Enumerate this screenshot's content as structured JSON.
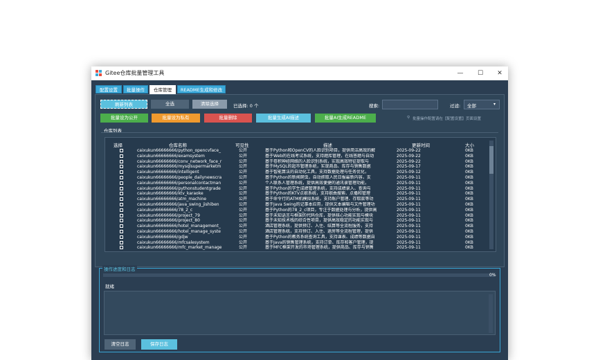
{
  "window": {
    "title": "Gitee仓库批量管理工具",
    "controls": {
      "minimize": "—",
      "maximize": "☐",
      "close": "✕"
    }
  },
  "tabs": [
    {
      "label": "配置设置",
      "active": false
    },
    {
      "label": "批量操作",
      "active": false
    },
    {
      "label": "仓库管理",
      "active": true
    },
    {
      "label": "README生成和修改",
      "active": false
    }
  ],
  "toolbar": {
    "refresh_label": "刷新列表",
    "select_all_label": "全选",
    "clear_selection_label": "清除选择",
    "selected_count": "已选择: 0 个",
    "search_label": "搜索:",
    "search_value": "",
    "filter_label": "过滤:",
    "filter_value": "全部",
    "set_public_label": "批量设为公开",
    "set_private_label": "批量设为私有",
    "delete_label": "批量删除",
    "ai_desc_label": "批量生成AI描述",
    "ai_readme_label": "批量AI生成README",
    "hint": "批量操作配置请在【配置设置】页面设置"
  },
  "repo_list": {
    "title": "仓库列表",
    "columns": [
      "选择",
      "仓库名称",
      "可见性",
      "描述",
      "更新时间",
      "大小"
    ],
    "rows": [
      [
        "caixukun66666666/python_opencvface_",
        "公开",
        "基于Python和OpenCV的人脸识别项目，提供简洁高效的解",
        "2025-09-22",
        "0KB"
      ],
      [
        "caixukun66666666/examsystem",
        "公开",
        "基于Web的在线考试系统，支持题库管理，在线答题与自动",
        "2025-09-22",
        "0KB"
      ],
      [
        "caixukun66666666/conv_network_face_r",
        "公开",
        "基于卷积神经网络的人脸识别系统，实现高效特征提取与",
        "2025-09-22",
        "0KB"
      ],
      [
        "caixukun66666666/mysqlsupermarketm",
        "公开",
        "基于MySQL的超市管理系统，实现商品、库存与销售数据",
        "2025-09-17",
        "0KB"
      ],
      [
        "caixukun66666666/intelligent",
        "公开",
        "基于智能算法的自动化工具，支持数据处理与任务优化，",
        "2025-09-12",
        "0KB"
      ],
      [
        "caixukun66666666/people_dailynewscra",
        "公开",
        "基于Python的新闻爬虫，自动抓取人民日报最新内容，支",
        "2025-09-11",
        "0KB"
      ],
      [
        "caixukun66666666/personalcontactman",
        "公开",
        "个人联系人管理系统，提供高效便捷的通讯录管理功能，",
        "2025-09-11",
        "0KB"
      ],
      [
        "caixukun66666666/pythonstudentgrade",
        "公开",
        "基于Python的学生成绩管理系统，支持成绩录入、查询与",
        "2025-09-11",
        "0KB"
      ],
      [
        "caixukun66666666/ktv_karaoke",
        "公开",
        "基于Python的KTV点歌系统，支持歌曲搜索、点播和管理",
        "2025-09-11",
        "0KB"
      ],
      [
        "caixukun66666666/atm_machine",
        "公开",
        "基于命令行的ATM机模拟系统，支持账户管理、存取款等功",
        "2025-09-11",
        "0KB"
      ],
      [
        "caixukun66666666/java_swing_jishiben",
        "公开",
        "基于Java Swing的记事本应用，提供文本编辑与文件管理功",
        "2025-09-11",
        "0KB"
      ],
      [
        "caixukun66666666/78_2_c",
        "公开",
        "基于Python的78_2_c项目，专注于数据处理与分析，提供高",
        "2025-09-11",
        "0KB"
      ],
      [
        "caixukun66666666/project_79",
        "公开",
        "基于未知语言与框架的代码仓库，提供核心功能实现与模块",
        "2025-09-11",
        "0KB"
      ],
      [
        "caixukun66666666/project_80",
        "公开",
        "基于未知技术栈的综合性项目，提供高效稳定的功能实现与",
        "2025-09-11",
        "0KB"
      ],
      [
        "caixukun66666666/hotel_management_",
        "公开",
        "酒店管理系统，提供预订、入住、结算等全流程服务，支持",
        "2025-09-11",
        "0KB"
      ],
      [
        "caixukun66666666/hotel_manage_syste",
        "公开",
        "酒店管理系统，支持预订、入住、退房等全流程管理，提供",
        "2025-09-11",
        "0KB"
      ],
      [
        "caixukun66666666/gdjw",
        "公开",
        "基于Python的教务系统查询工具，支持课表、成绩等数据自",
        "2025-09-11",
        "0KB"
      ],
      [
        "caixukun66666666/mfcsalesystem",
        "公开",
        "基于Java的销售管理系统，支持订单、库存和客户管理，提",
        "2025-09-11",
        "0KB"
      ],
      [
        "caixukun66666666/mfc_market_manage",
        "公开",
        "基于MFC框架开发的市场管理系统，提供商品、库存与销售",
        "2025-09-11",
        "0KB"
      ]
    ]
  },
  "log": {
    "title": "操作进度和日志",
    "progress": 0,
    "progress_label": "0%",
    "status": "就绪",
    "content": "",
    "clear_label": "清空日志",
    "save_label": "保存日志"
  },
  "colors": {
    "window_bg": "#2b3e52",
    "accent_blue": "#3aa8d8",
    "green": "#4cae4c",
    "orange": "#ef9a2e",
    "red": "#d9534f",
    "light_blue": "#5bc0de",
    "grey": "#8a9aaa"
  }
}
